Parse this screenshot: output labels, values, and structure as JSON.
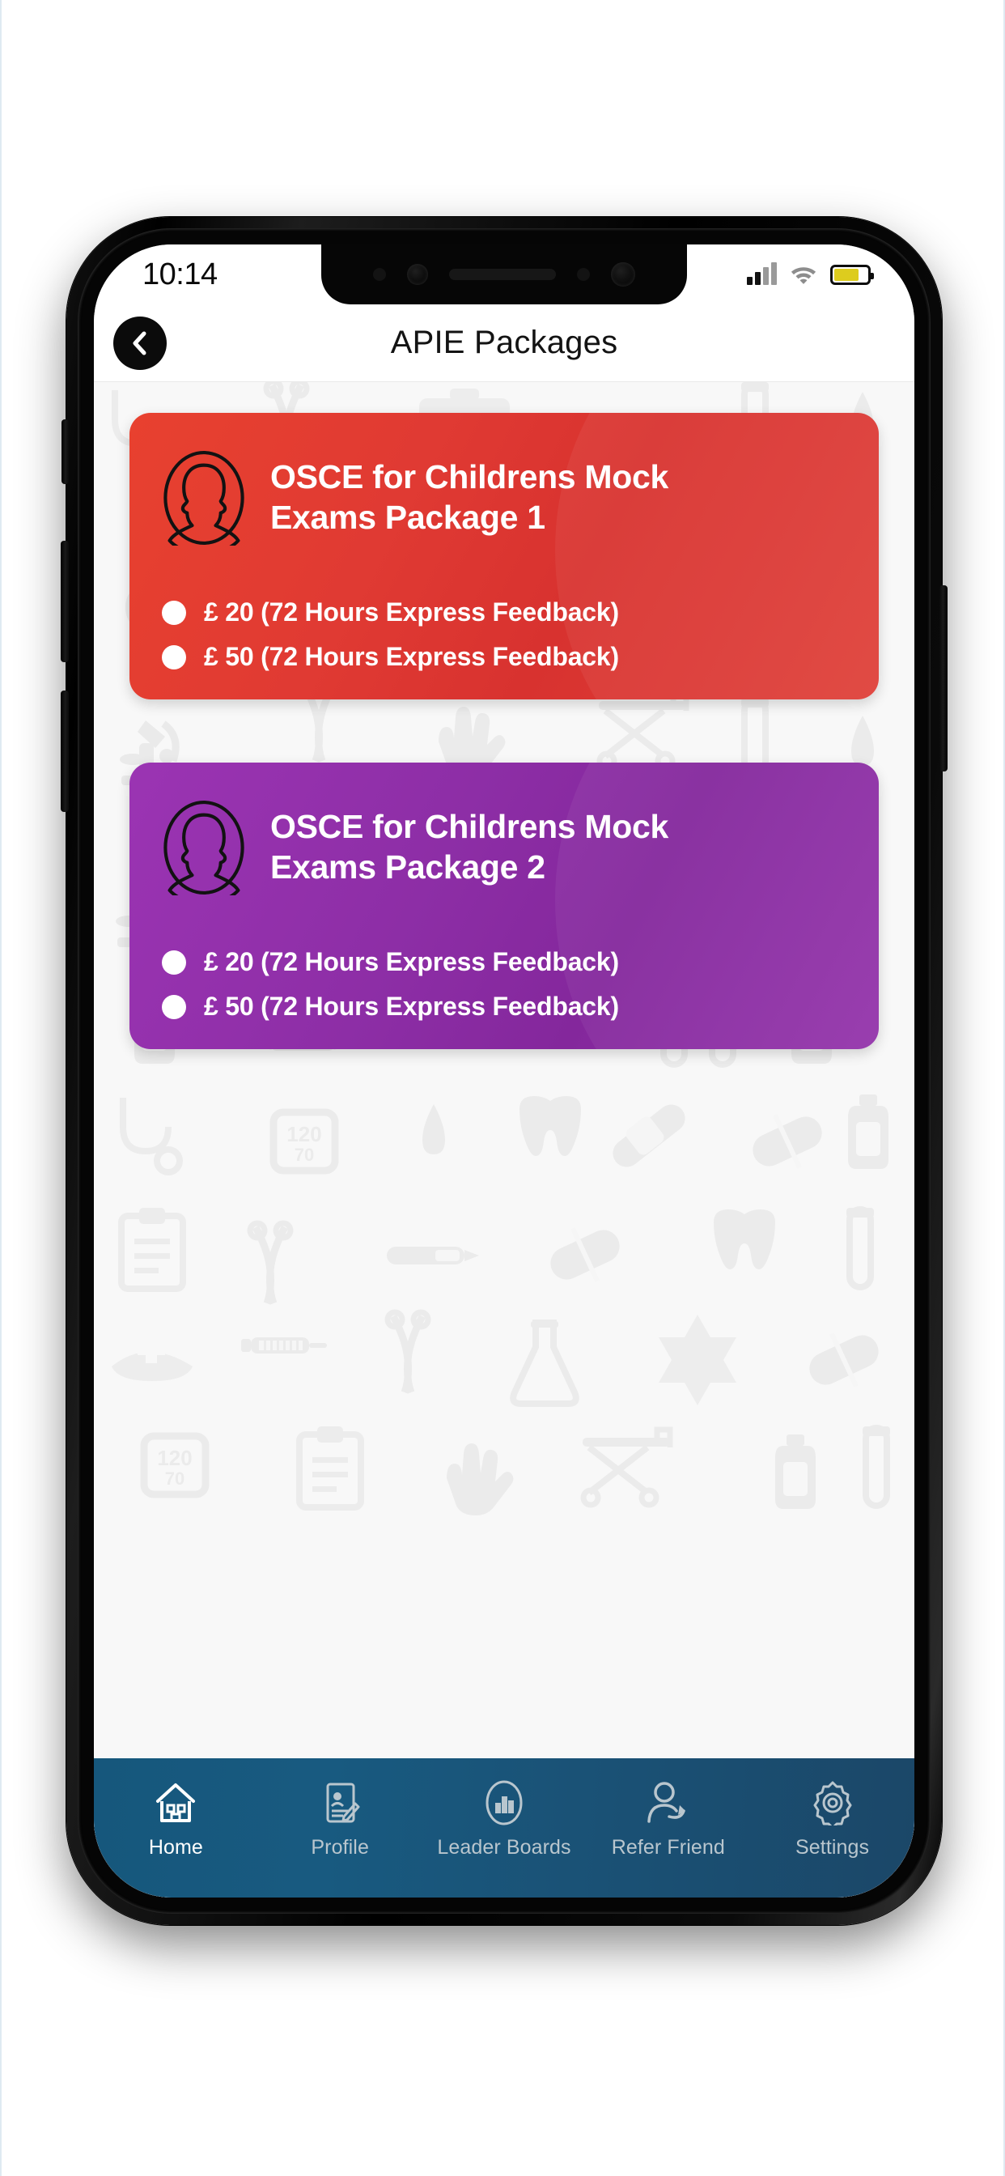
{
  "status_bar": {
    "time": "10:14",
    "signal_icon": "cellular-signal-icon",
    "wifi_icon": "wifi-icon",
    "battery_icon": "battery-icon",
    "battery_color": "#ddcc1e"
  },
  "header": {
    "back_icon": "chevron-left-icon",
    "title": "APIE Packages"
  },
  "cards": [
    {
      "id": "package-1",
      "accent_color": "#e03a33",
      "avatar_icon": "person-avatar-icon",
      "title": "OSCE for Childrens Mock Exams Package 1",
      "options": [
        {
          "label": "£ 20 (72 Hours Express Feedback)",
          "selected": false
        },
        {
          "label": "£ 50 (72 Hours Express Feedback)",
          "selected": false
        }
      ]
    },
    {
      "id": "package-2",
      "accent_color": "#8d2ea6",
      "avatar_icon": "person-avatar-icon",
      "title": "OSCE for Childrens Mock Exams Package 2",
      "options": [
        {
          "label": "£ 20 (72 Hours Express Feedback)",
          "selected": false
        },
        {
          "label": "£ 50 (72 Hours Express Feedback)",
          "selected": false
        }
      ]
    }
  ],
  "bottom_nav": {
    "background_color": "#1a5579",
    "active_index": 0,
    "items": [
      {
        "label": "Home",
        "icon": "home-icon",
        "active": true
      },
      {
        "label": "Profile",
        "icon": "profile-card-icon",
        "active": false
      },
      {
        "label": "Leader Boards",
        "icon": "bar-chart-icon",
        "active": false
      },
      {
        "label": "Refer Friend",
        "icon": "person-share-icon",
        "active": false
      },
      {
        "label": "Settings",
        "icon": "gear-icon",
        "active": false
      }
    ]
  }
}
